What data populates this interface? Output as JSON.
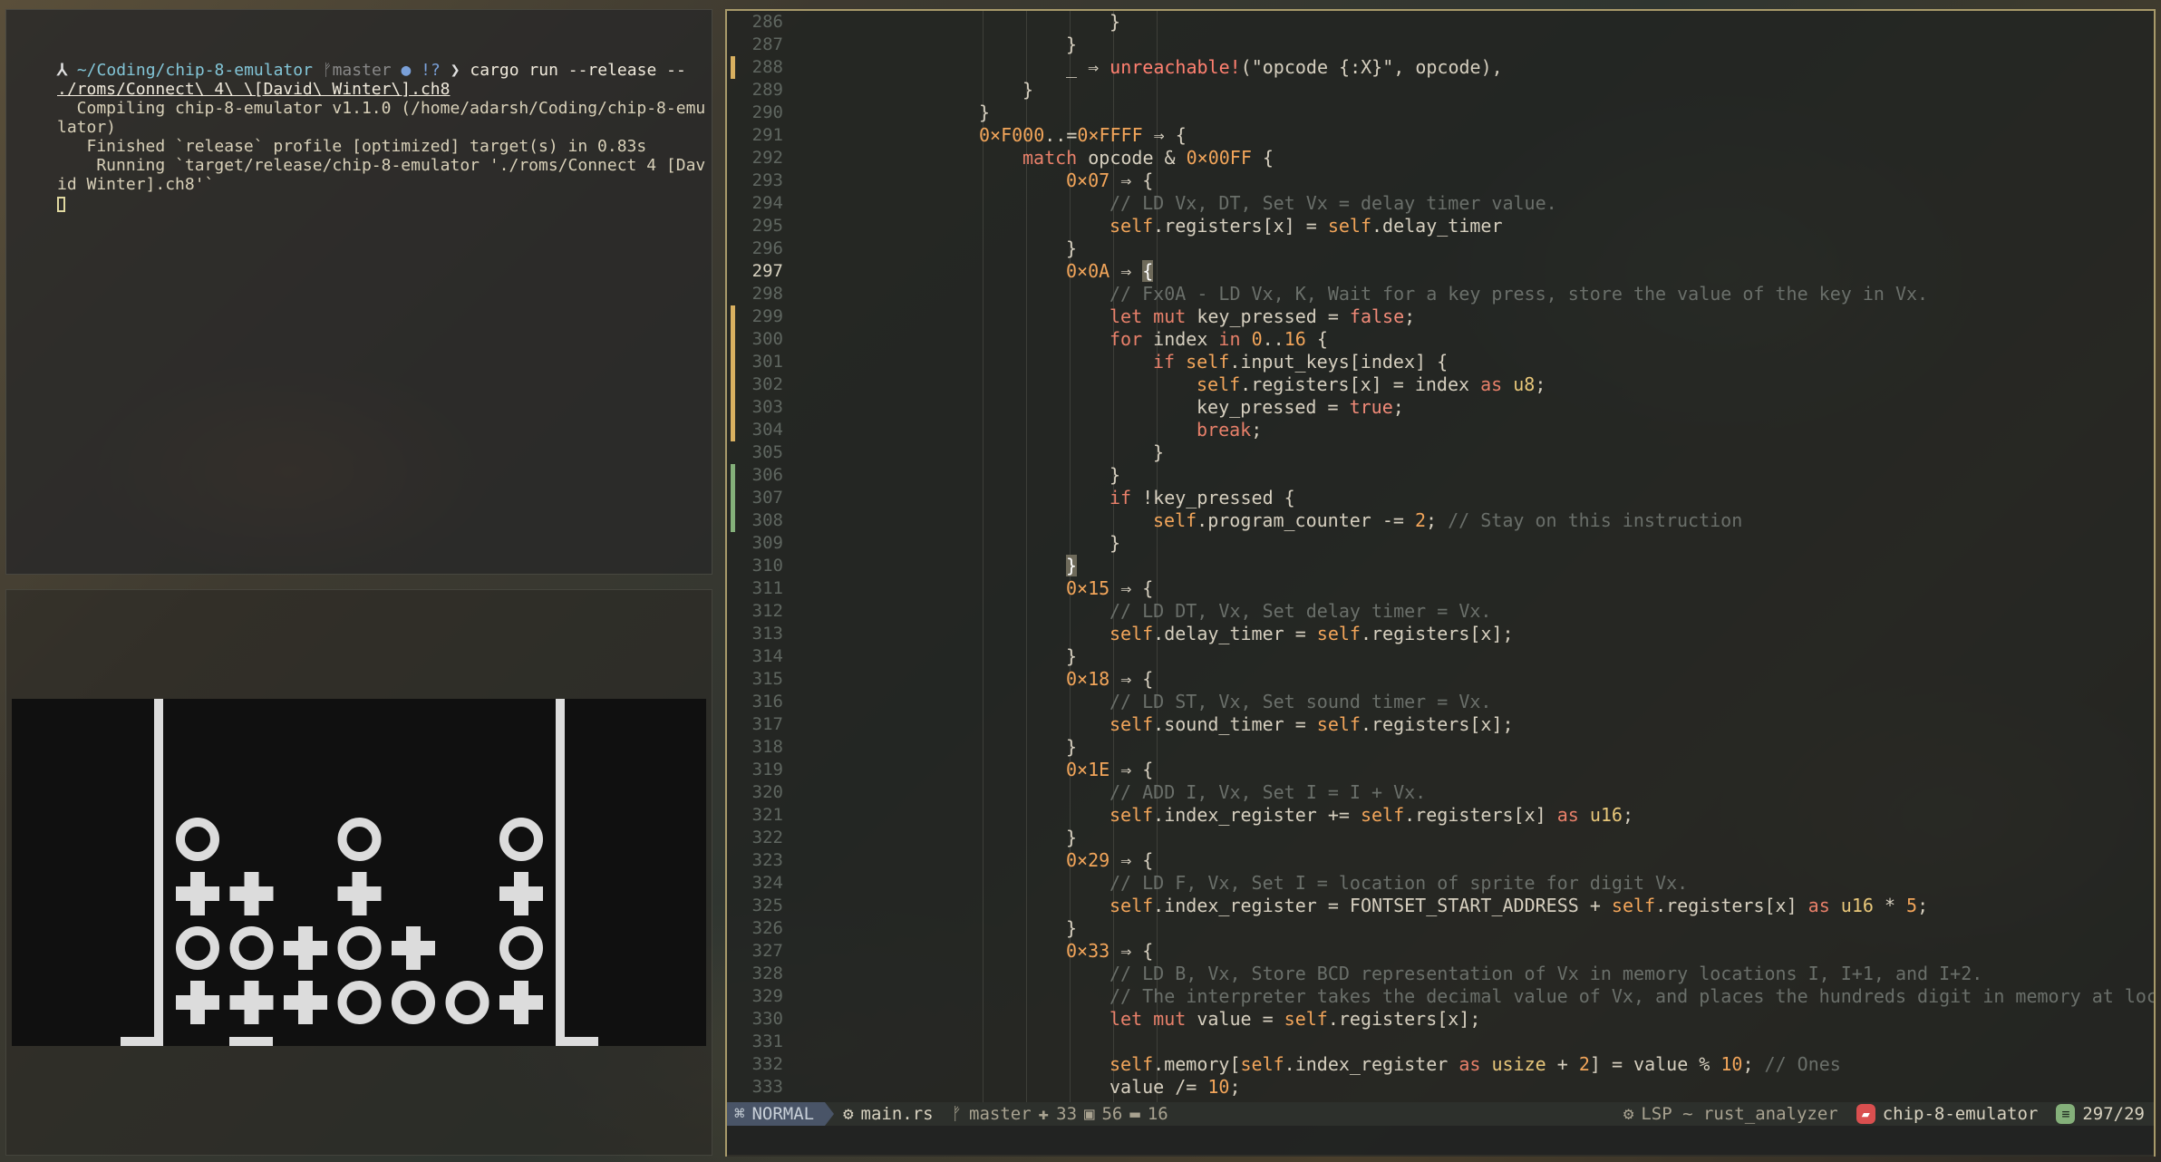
{
  "terminal": {
    "prompt_symbol": "⅄",
    "cwd": "~/Coding/chip-8-emulator",
    "git_branch_icon": "branch-icon",
    "git_branch": "master",
    "git_status_dot": "●",
    "git_status": "!?",
    "prompt_arrow": "❯",
    "command": "cargo run --release --",
    "command_arg": "./roms/Connect\\ 4\\ \\[David\\ Winter\\].ch8",
    "output": [
      "  Compiling chip-8-emulator v1.1.0 (/home/adarsh/Coding/chip-8-emu",
      "lator)",
      "   Finished `release` profile [optimized] target(s) in 0.83s",
      "    Running `target/release/chip-8-emulator './roms/Connect 4 [Dav",
      "id Winter].ch8'`"
    ]
  },
  "emulator": {
    "rom": "Connect 4 [David Winter]",
    "board": [
      [
        "o",
        ".",
        ".",
        "o",
        ".",
        ".",
        "o"
      ],
      [
        "x",
        "x",
        ".",
        "x",
        ".",
        ".",
        "x"
      ],
      [
        "o",
        "o",
        "x",
        "o",
        "x",
        ".",
        "o"
      ],
      [
        "x",
        "x",
        "x",
        "o",
        "o",
        "o",
        "x"
      ]
    ]
  },
  "editor": {
    "lines": [
      {
        "n": "286",
        "indent": 7,
        "tokens": [
          [
            "op",
            "}"
          ]
        ]
      },
      {
        "n": "287",
        "indent": 6,
        "tokens": [
          [
            "op",
            "}"
          ]
        ]
      },
      {
        "n": "288",
        "indent": 6,
        "mark": "#d8b060",
        "tokens": [
          [
            "op",
            "_ ⇒ "
          ],
          [
            "mac",
            "unreachable!"
          ],
          [
            "str",
            "(\"opcode {:X}\", opcode),"
          ]
        ]
      },
      {
        "n": "289",
        "indent": 5,
        "tokens": [
          [
            "op",
            "}"
          ]
        ]
      },
      {
        "n": "290",
        "indent": 4,
        "tokens": [
          [
            "op",
            "}"
          ]
        ]
      },
      {
        "n": "291",
        "indent": 4,
        "tokens": [
          [
            "num",
            "0×F000"
          ],
          [
            "op",
            "..="
          ],
          [
            "num",
            "0×FFFF"
          ],
          [
            "op",
            " ⇒ {"
          ]
        ]
      },
      {
        "n": "292",
        "indent": 5,
        "tokens": [
          [
            "kw",
            "match"
          ],
          [
            "op",
            " opcode & "
          ],
          [
            "num",
            "0×00FF"
          ],
          [
            "op",
            " {"
          ]
        ]
      },
      {
        "n": "293",
        "indent": 6,
        "tokens": [
          [
            "num",
            "0×07"
          ],
          [
            "op",
            " ⇒ {"
          ]
        ]
      },
      {
        "n": "294",
        "indent": 7,
        "tokens": [
          [
            "cmt",
            "// LD Vx, DT, Set Vx = delay timer value."
          ]
        ]
      },
      {
        "n": "295",
        "indent": 7,
        "tokens": [
          [
            "self",
            "self"
          ],
          [
            "op",
            ".registers[x] = "
          ],
          [
            "self",
            "self"
          ],
          [
            "op",
            ".delay_timer"
          ]
        ]
      },
      {
        "n": "296",
        "indent": 6,
        "tokens": [
          [
            "op",
            "}"
          ]
        ]
      },
      {
        "n": "297",
        "indent": 6,
        "cur": true,
        "tokens": [
          [
            "num",
            "0×0A"
          ],
          [
            "op",
            " ⇒ "
          ],
          [
            "brk",
            "{"
          ]
        ]
      },
      {
        "n": "298",
        "indent": 7,
        "tokens": [
          [
            "cmt",
            "// Fx0A - LD Vx, K, Wait for a key press, store the value of the key in Vx."
          ]
        ]
      },
      {
        "n": "299",
        "indent": 7,
        "mark": "#d8b060",
        "tokens": [
          [
            "kw",
            "let"
          ],
          [
            "op",
            " "
          ],
          [
            "kw",
            "mut"
          ],
          [
            "op",
            " key_pressed = "
          ],
          [
            "bool",
            "false"
          ],
          [
            "op",
            ";"
          ]
        ]
      },
      {
        "n": "300",
        "indent": 7,
        "mark": "#d8b060",
        "tokens": [
          [
            "kw",
            "for"
          ],
          [
            "op",
            " index "
          ],
          [
            "kw",
            "in"
          ],
          [
            "op",
            " "
          ],
          [
            "num",
            "0"
          ],
          [
            "op",
            ".."
          ],
          [
            "num",
            "16"
          ],
          [
            "op",
            " {"
          ]
        ]
      },
      {
        "n": "301",
        "indent": 8,
        "mark": "#d8b060",
        "tokens": [
          [
            "kw",
            "if"
          ],
          [
            "op",
            " "
          ],
          [
            "self",
            "self"
          ],
          [
            "op",
            ".input_keys[index] {"
          ]
        ]
      },
      {
        "n": "302",
        "indent": 9,
        "mark": "#d8b060",
        "tokens": [
          [
            "self",
            "self"
          ],
          [
            "op",
            ".registers[x] = index "
          ],
          [
            "kw",
            "as"
          ],
          [
            "op",
            " "
          ],
          [
            "ty",
            "u8"
          ],
          [
            "op",
            ";"
          ]
        ]
      },
      {
        "n": "303",
        "indent": 9,
        "mark": "#d8b060",
        "tokens": [
          [
            "op",
            "key_pressed = "
          ],
          [
            "bool",
            "true"
          ],
          [
            "op",
            ";"
          ]
        ]
      },
      {
        "n": "304",
        "indent": 9,
        "mark": "#d8b060",
        "tokens": [
          [
            "kw",
            "break"
          ],
          [
            "op",
            ";"
          ]
        ]
      },
      {
        "n": "305",
        "indent": 8,
        "tokens": [
          [
            "op",
            "}"
          ]
        ]
      },
      {
        "n": "306",
        "indent": 7,
        "mark": "#84b07a",
        "tokens": [
          [
            "op",
            "}"
          ]
        ]
      },
      {
        "n": "307",
        "indent": 7,
        "mark": "#84b07a",
        "tokens": [
          [
            "kw",
            "if"
          ],
          [
            "op",
            " !key_pressed {"
          ]
        ]
      },
      {
        "n": "308",
        "indent": 8,
        "mark": "#84b07a",
        "tokens": [
          [
            "self",
            "self"
          ],
          [
            "op",
            ".program_counter -= "
          ],
          [
            "num",
            "2"
          ],
          [
            "op",
            "; "
          ],
          [
            "cmt",
            "// Stay on this instruction"
          ]
        ]
      },
      {
        "n": "309",
        "indent": 7,
        "tokens": [
          [
            "op",
            "}"
          ]
        ]
      },
      {
        "n": "310",
        "indent": 6,
        "tokens": [
          [
            "brk",
            "}"
          ]
        ]
      },
      {
        "n": "311",
        "indent": 6,
        "tokens": [
          [
            "num",
            "0×15"
          ],
          [
            "op",
            " ⇒ {"
          ]
        ]
      },
      {
        "n": "312",
        "indent": 7,
        "tokens": [
          [
            "cmt",
            "// LD DT, Vx, Set delay timer = Vx."
          ]
        ]
      },
      {
        "n": "313",
        "indent": 7,
        "tokens": [
          [
            "self",
            "self"
          ],
          [
            "op",
            ".delay_timer = "
          ],
          [
            "self",
            "self"
          ],
          [
            "op",
            ".registers[x];"
          ]
        ]
      },
      {
        "n": "314",
        "indent": 6,
        "tokens": [
          [
            "op",
            "}"
          ]
        ]
      },
      {
        "n": "315",
        "indent": 6,
        "tokens": [
          [
            "num",
            "0×18"
          ],
          [
            "op",
            " ⇒ {"
          ]
        ]
      },
      {
        "n": "316",
        "indent": 7,
        "tokens": [
          [
            "cmt",
            "// LD ST, Vx, Set sound timer = Vx."
          ]
        ]
      },
      {
        "n": "317",
        "indent": 7,
        "tokens": [
          [
            "self",
            "self"
          ],
          [
            "op",
            ".sound_timer = "
          ],
          [
            "self",
            "self"
          ],
          [
            "op",
            ".registers[x];"
          ]
        ]
      },
      {
        "n": "318",
        "indent": 6,
        "tokens": [
          [
            "op",
            "}"
          ]
        ]
      },
      {
        "n": "319",
        "indent": 6,
        "tokens": [
          [
            "num",
            "0×1E"
          ],
          [
            "op",
            " ⇒ {"
          ]
        ]
      },
      {
        "n": "320",
        "indent": 7,
        "tokens": [
          [
            "cmt",
            "// ADD I, Vx, Set I = I + Vx."
          ]
        ]
      },
      {
        "n": "321",
        "indent": 7,
        "tokens": [
          [
            "self",
            "self"
          ],
          [
            "op",
            ".index_register += "
          ],
          [
            "self",
            "self"
          ],
          [
            "op",
            ".registers[x] "
          ],
          [
            "kw",
            "as"
          ],
          [
            "op",
            " "
          ],
          [
            "ty",
            "u16"
          ],
          [
            "op",
            ";"
          ]
        ]
      },
      {
        "n": "322",
        "indent": 6,
        "tokens": [
          [
            "op",
            "}"
          ]
        ]
      },
      {
        "n": "323",
        "indent": 6,
        "tokens": [
          [
            "num",
            "0×29"
          ],
          [
            "op",
            " ⇒ {"
          ]
        ]
      },
      {
        "n": "324",
        "indent": 7,
        "tokens": [
          [
            "cmt",
            "// LD F, Vx, Set I = location of sprite for digit Vx."
          ]
        ]
      },
      {
        "n": "325",
        "indent": 7,
        "tokens": [
          [
            "self",
            "self"
          ],
          [
            "op",
            ".index_register = FONTSET_START_ADDRESS + "
          ],
          [
            "self",
            "self"
          ],
          [
            "op",
            ".registers[x] "
          ],
          [
            "kw",
            "as"
          ],
          [
            "op",
            " "
          ],
          [
            "ty",
            "u16"
          ],
          [
            "op",
            " * "
          ],
          [
            "num",
            "5"
          ],
          [
            "op",
            ";"
          ]
        ]
      },
      {
        "n": "326",
        "indent": 6,
        "tokens": [
          [
            "op",
            "}"
          ]
        ]
      },
      {
        "n": "327",
        "indent": 6,
        "tokens": [
          [
            "num",
            "0×33"
          ],
          [
            "op",
            " ⇒ {"
          ]
        ]
      },
      {
        "n": "328",
        "indent": 7,
        "tokens": [
          [
            "cmt",
            "// LD B, Vx, Store BCD representation of Vx in memory locations I, I+1, and I+2."
          ]
        ]
      },
      {
        "n": "329",
        "indent": 7,
        "tokens": [
          [
            "cmt",
            "// The interpreter takes the decimal value of Vx, and places the hundreds digit in memory at locatio"
          ]
        ]
      },
      {
        "n": "330",
        "indent": 7,
        "tokens": [
          [
            "kw",
            "let"
          ],
          [
            "op",
            " "
          ],
          [
            "kw",
            "mut"
          ],
          [
            "op",
            " value = "
          ],
          [
            "self",
            "self"
          ],
          [
            "op",
            ".registers[x];"
          ]
        ]
      },
      {
        "n": "331",
        "indent": 0,
        "tokens": []
      },
      {
        "n": "332",
        "indent": 7,
        "tokens": [
          [
            "self",
            "self"
          ],
          [
            "op",
            ".memory["
          ],
          [
            "self",
            "self"
          ],
          [
            "op",
            ".index_register "
          ],
          [
            "kw",
            "as"
          ],
          [
            "op",
            " "
          ],
          [
            "ty",
            "usize"
          ],
          [
            "op",
            " + "
          ],
          [
            "num",
            "2"
          ],
          [
            "op",
            "] = value % "
          ],
          [
            "num",
            "10"
          ],
          [
            "op",
            "; "
          ],
          [
            "cmt",
            "// Ones"
          ]
        ]
      },
      {
        "n": "333",
        "indent": 7,
        "tokens": [
          [
            "op",
            "value /= "
          ],
          [
            "num",
            "10"
          ],
          [
            "op",
            ";"
          ]
        ]
      }
    ],
    "statusbar": {
      "mode_icon": "vim-icon",
      "mode": "NORMAL",
      "file_icon": "rust-icon",
      "file": "main.rs",
      "branch_icon": "branch-icon",
      "branch": "master",
      "added": "33",
      "modified": "56",
      "removed": "16",
      "lsp_icon": "gear-icon",
      "lsp": "LSP ~ rust_analyzer",
      "project_icon": "folder-icon",
      "project": "chip-8-emulator",
      "position_icon": "lines-icon",
      "position": "297/29"
    }
  },
  "colors": {
    "accent_border": "#a89a6a",
    "git_added": "#84b07a",
    "git_modified": "#d8b060",
    "project_badge": "#d94f4f"
  }
}
